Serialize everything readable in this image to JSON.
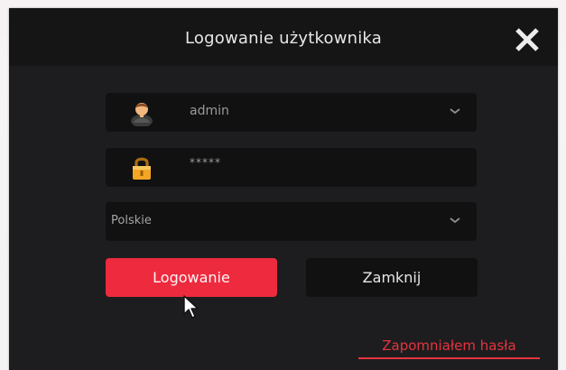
{
  "dialog": {
    "title": "Logowanie użytkownika",
    "close_icon": "close-icon"
  },
  "fields": {
    "username": {
      "icon": "user-icon",
      "value": "admin",
      "dropdown_icon": "chevron-down-icon"
    },
    "password": {
      "icon": "lock-icon",
      "value": "*****"
    },
    "language": {
      "value": "Polskie",
      "dropdown_icon": "chevron-down-icon"
    }
  },
  "buttons": {
    "login": "Logowanie",
    "close": "Zamknij"
  },
  "links": {
    "forgot_password": "Zapomniałem hasła"
  },
  "colors": {
    "accent": "#ee2a3e",
    "dialog_bg": "#1d1d1f",
    "field_bg": "#111112",
    "text": "#e7e7e7"
  }
}
